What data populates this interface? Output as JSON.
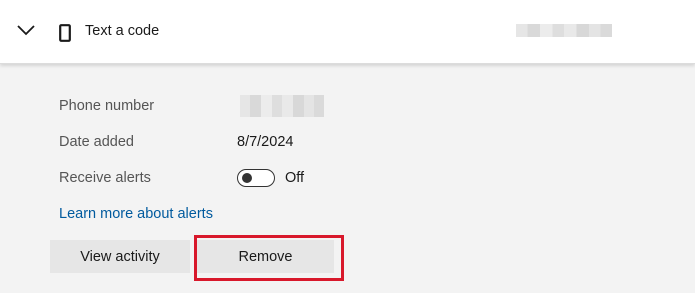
{
  "method": {
    "title": "Text a code",
    "expand_icon": "chevron-down-icon",
    "type_icon": "phone-icon"
  },
  "details": {
    "phone_number_label": "Phone number",
    "date_added_label": "Date added",
    "date_added_value": "8/7/2024",
    "receive_alerts_label": "Receive alerts",
    "receive_alerts_state": "Off",
    "receive_alerts_on": false
  },
  "links": {
    "learn_more": "Learn more about alerts"
  },
  "actions": {
    "view_activity": "View activity",
    "remove": "Remove"
  },
  "colors": {
    "link": "#005a9e",
    "highlight": "#d8182b",
    "button_bg": "#e6e6e6"
  }
}
